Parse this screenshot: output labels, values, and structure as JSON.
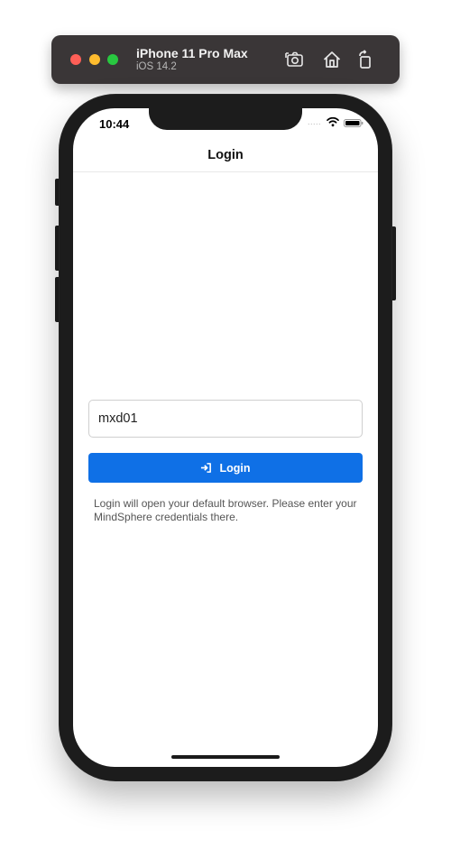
{
  "simulator": {
    "device_name": "iPhone 11 Pro Max",
    "os_version": "iOS 14.2",
    "buttons": [
      {
        "icon": "screenshot-icon"
      },
      {
        "icon": "home-icon"
      },
      {
        "icon": "rotate-icon"
      }
    ]
  },
  "status_bar": {
    "time": "10:44",
    "signal": "....."
  },
  "nav": {
    "title": "Login"
  },
  "login_form": {
    "username_value": "mxd01",
    "button_label": "Login",
    "button_icon": "sign-in-icon",
    "accent_color": "#0f70e6",
    "help_text": "Login will open your default browser. Please enter your MindSphere credentials there."
  }
}
